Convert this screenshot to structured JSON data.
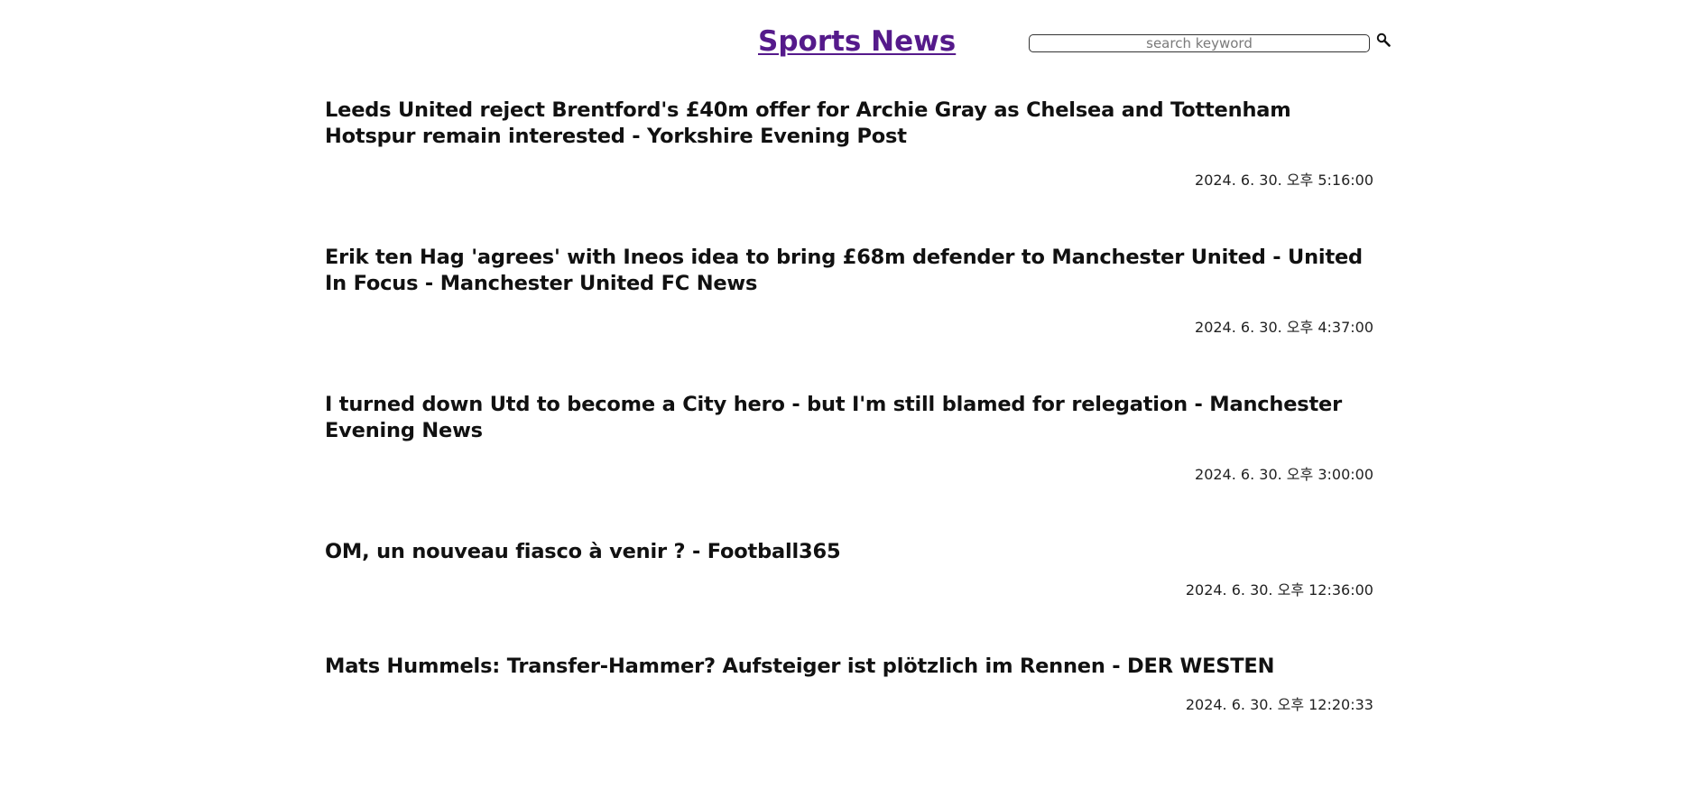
{
  "header": {
    "title": "Sports News",
    "search_placeholder": "search keyword",
    "search_value": "",
    "search_icon": "magnifier-icon"
  },
  "news": [
    {
      "title": "Leeds United reject Brentford's £40m offer for Archie Gray as Chelsea and Tottenham Hotspur remain interested - Yorkshire Evening Post",
      "date": "2024. 6. 30. 오후 5:16:00"
    },
    {
      "title": "Erik ten Hag 'agrees' with Ineos idea to bring £68m defender to Manchester United - United In Focus - Manchester United FC News",
      "date": "2024. 6. 30. 오후 4:37:00"
    },
    {
      "title": "I turned down Utd to become a City hero - but I'm still blamed for relegation - Manchester Evening News",
      "date": "2024. 6. 30. 오후 3:00:00"
    },
    {
      "title": "OM, un nouveau fiasco à venir ? - Football365",
      "date": "2024. 6. 30. 오후 12:36:00"
    },
    {
      "title": "Mats Hummels: Transfer-Hammer? Aufsteiger ist plötzlich im Rennen - DER WESTEN",
      "date": "2024. 6. 30. 오후 12:20:33"
    }
  ]
}
